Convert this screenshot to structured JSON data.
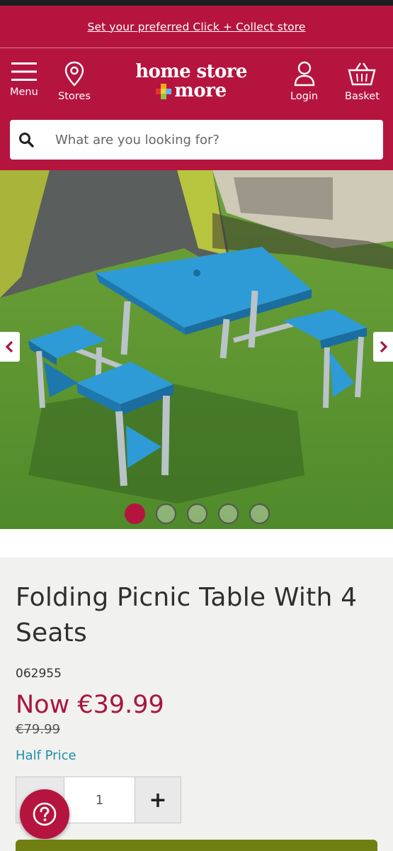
{
  "banner": {
    "link_text": "Set your preferred Click + Collect store"
  },
  "header": {
    "menu_label": "Menu",
    "stores_label": "Stores",
    "logo_line1": "home store",
    "logo_line2": "more",
    "login_label": "Login",
    "basket_label": "Basket"
  },
  "search": {
    "placeholder": "What are you looking for?",
    "value": ""
  },
  "gallery": {
    "image_count": 5,
    "active_index": 0
  },
  "product": {
    "title": "Folding Picnic Table With 4 Seats",
    "sku": "062955",
    "now_price": "Now €39.99",
    "was_price": "€79.99",
    "deal": "Half Price"
  },
  "quantity": {
    "value": "1",
    "plus": "+"
  },
  "colors": {
    "brand": "#b5143f",
    "price": "#a8163e",
    "deal": "#1f8fa8",
    "cart": "#707f12"
  },
  "icons": [
    "menu-icon",
    "location-pin-icon",
    "user-icon",
    "basket-icon",
    "search-icon",
    "chevron-left-icon",
    "chevron-right-icon",
    "help-icon"
  ]
}
